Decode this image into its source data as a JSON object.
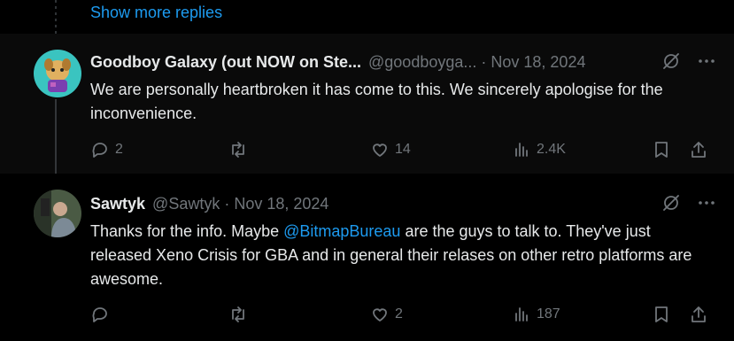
{
  "replies": {
    "show_more_label": "Show more replies"
  },
  "tweets": [
    {
      "name": "Goodboy Galaxy (out NOW on Ste...",
      "handle": "@goodboyga...",
      "separator": "·",
      "date": "Nov 18, 2024",
      "text": "We are personally heartbroken it has come to this. We sincerely apologise for the inconvenience.",
      "replies": "2",
      "retweets": "",
      "likes": "14",
      "views": "2.4K",
      "avatar_colors": [
        "#3ac4c0",
        "#e0b060",
        "#7a3fb0"
      ]
    },
    {
      "name": "Sawtyk",
      "handle": "@Sawtyk",
      "separator": "·",
      "date": "Nov 18, 2024",
      "text_before": "Thanks for the info. Maybe ",
      "mention": "@BitmapBureau",
      "text_after": " are the guys to talk to. They've just released Xeno Crisis for GBA and in general their relases on other retro platforms are awesome.",
      "replies": "",
      "retweets": "",
      "likes": "2",
      "views": "187"
    }
  ],
  "colors": {
    "accent": "#1d9bf0",
    "muted": "#71767b",
    "text": "#e7e9ea",
    "bg": "#000000"
  },
  "icons": [
    "grok-icon",
    "more-icon",
    "reply-icon",
    "retweet-icon",
    "like-icon",
    "views-icon",
    "bookmark-icon",
    "share-icon"
  ]
}
